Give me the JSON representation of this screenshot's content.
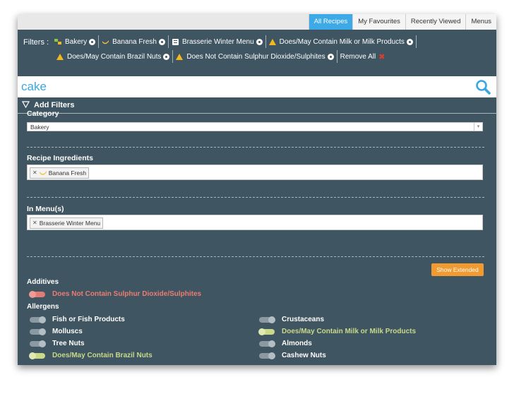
{
  "tabs": [
    {
      "label": "All Recipes",
      "active": true
    },
    {
      "label": "My Favourites",
      "active": false
    },
    {
      "label": "Recently Viewed",
      "active": false
    },
    {
      "label": "Menus",
      "active": false
    }
  ],
  "filters": {
    "label": "Filters :",
    "chips": [
      {
        "label": "Bakery",
        "icon": "bakery-icon"
      },
      {
        "label": "Banana Fresh",
        "icon": "ingredient-icon"
      },
      {
        "label": "Brasserie Winter Menu",
        "icon": "menu-icon"
      },
      {
        "label": "Does/May Contain Milk or Milk Products",
        "icon": "warning-icon"
      },
      {
        "label": "Does/May Contain Brazil Nuts",
        "icon": "warning-icon"
      },
      {
        "label": "Does Not Contain Sulphur Dioxide/Sulphites",
        "icon": "warning-icon"
      }
    ],
    "remove_all": "Remove All"
  },
  "search": {
    "value": "cake",
    "icon": "search-icon"
  },
  "add_filters": {
    "label": "Add Filters"
  },
  "category": {
    "title": "Category",
    "selected": "Bakery"
  },
  "ingredients": {
    "title": "Recipe Ingredients",
    "tag": "Banana Fresh"
  },
  "menus": {
    "title": "In Menu(s)",
    "tag": "Brasserie Winter Menu"
  },
  "show_extended": "Show Extended",
  "additives": {
    "title": "Additives",
    "items": [
      {
        "label": "Does Not Contain Sulphur Dioxide/Sulphites",
        "state": "excluded"
      }
    ]
  },
  "allergens": {
    "title": "Allergens",
    "items": [
      {
        "label": "Fish or Fish Products",
        "state": "off"
      },
      {
        "label": "Crustaceans",
        "state": "off"
      },
      {
        "label": "Molluscs",
        "state": "off"
      },
      {
        "label": "Does/May Contain Milk or Milk Products",
        "state": "included"
      },
      {
        "label": "Tree Nuts",
        "state": "off"
      },
      {
        "label": "Almonds",
        "state": "off"
      },
      {
        "label": "Does/May Contain Brazil Nuts",
        "state": "included"
      },
      {
        "label": "Cashew Nuts",
        "state": "off"
      }
    ]
  },
  "colors": {
    "panel": "#3f5561",
    "accent": "#3aa7e3",
    "button": "#f19a2f",
    "included": "#c8d98a",
    "excluded": "#ee7b72"
  }
}
